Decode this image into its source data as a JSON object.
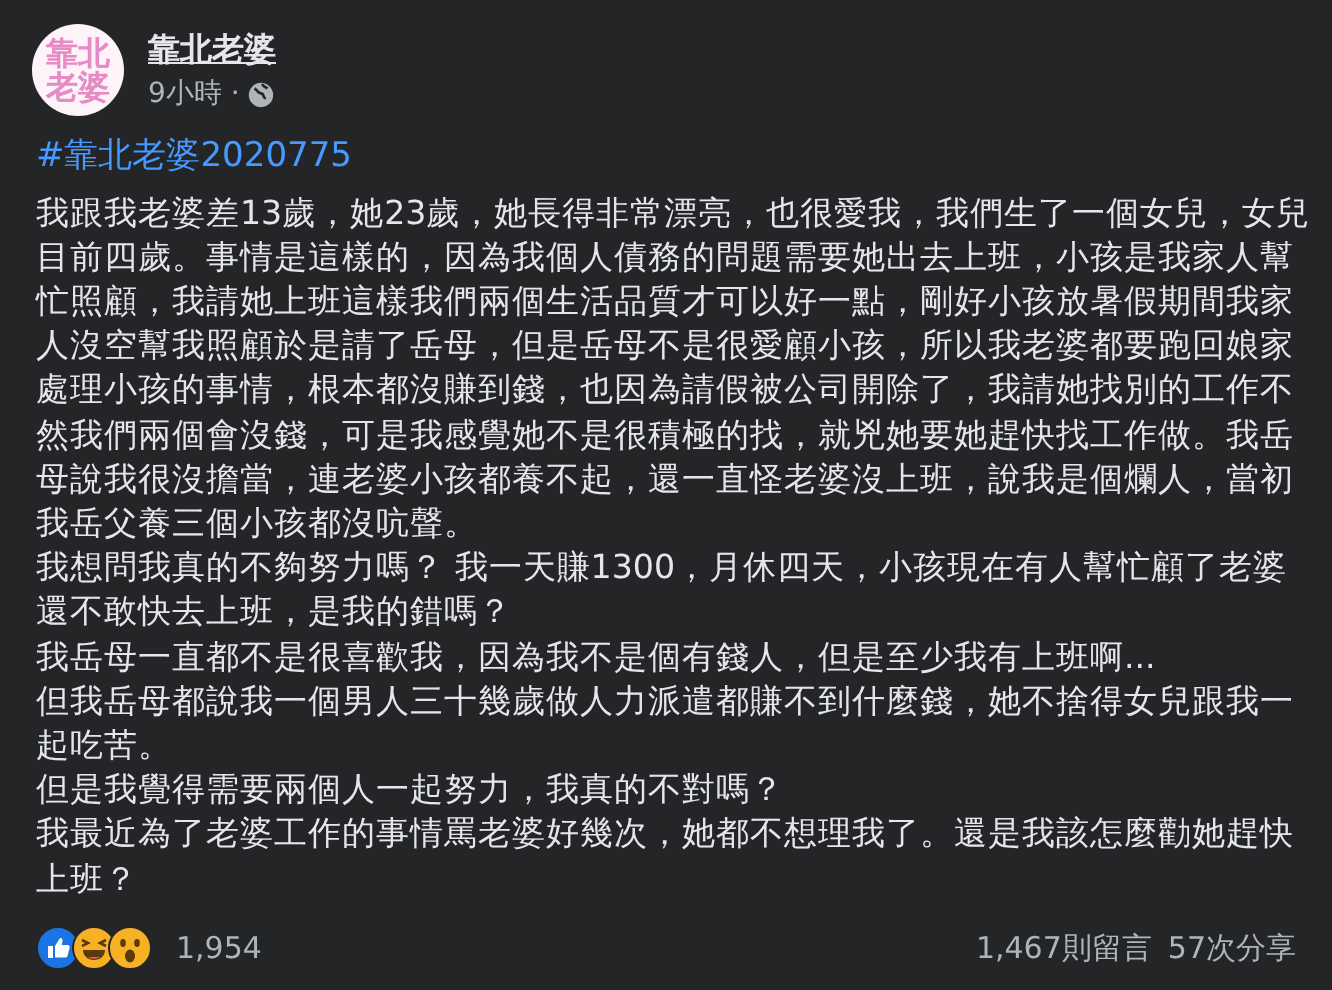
{
  "post": {
    "avatar_text": "靠北老婆",
    "author": "靠北老婆",
    "time": "9小時 ·",
    "hashtag": "#靠北老婆2020775",
    "paragraphs": [
      "我跟我老婆差13歲，她23歲，她長得非常漂亮，也很愛我，我們生了一個女兒，女兒目前四歲。事情是這樣的，因為我個人債務的問題需要她出去上班，小孩是我家人幫忙照顧，我請她上班這樣我們兩個生活品質才可以好一點，剛好小孩放暑假期間我家人沒空幫我照顧於是請了岳母，但是岳母不是很愛顧小孩，所以我老婆都要跑回娘家處理小孩的事情，根本都沒賺到錢，也因為請假被公司開除了，我請她找別的工作不然我們兩個會沒錢，可是我感覺她不是很積極的找，就兇她要她趕快找工作做。我岳母說我很沒擔當，連老婆小孩都養不起，還一直怪老婆沒上班，說我是個爛人，當初我岳父養三個小孩都沒吭聲。",
      "我想問我真的不夠努力嗎？ 我一天賺1300，月休四天，小孩現在有人幫忙顧了老婆還不敢快去上班，是我的錯嗎？",
      "我岳母一直都不是很喜歡我，因為我不是個有錢人，但是至少我有上班啊...",
      "但我岳母都說我一個男人三十幾歲做人力派遣都賺不到什麼錢，她不捨得女兒跟我一起吃苦。",
      "但是我覺得需要兩個人一起努力，我真的不對嗎？",
      "我最近為了老婆工作的事情罵老婆好幾次，她都不想理我了。還是我該怎麼勸她趕快上班？"
    ],
    "reactions": [
      {
        "kind": "like"
      },
      {
        "kind": "haha"
      },
      {
        "kind": "wow"
      }
    ],
    "reaction_count": "1,954",
    "comments": "1,467則留言",
    "shares": "57次分享"
  }
}
